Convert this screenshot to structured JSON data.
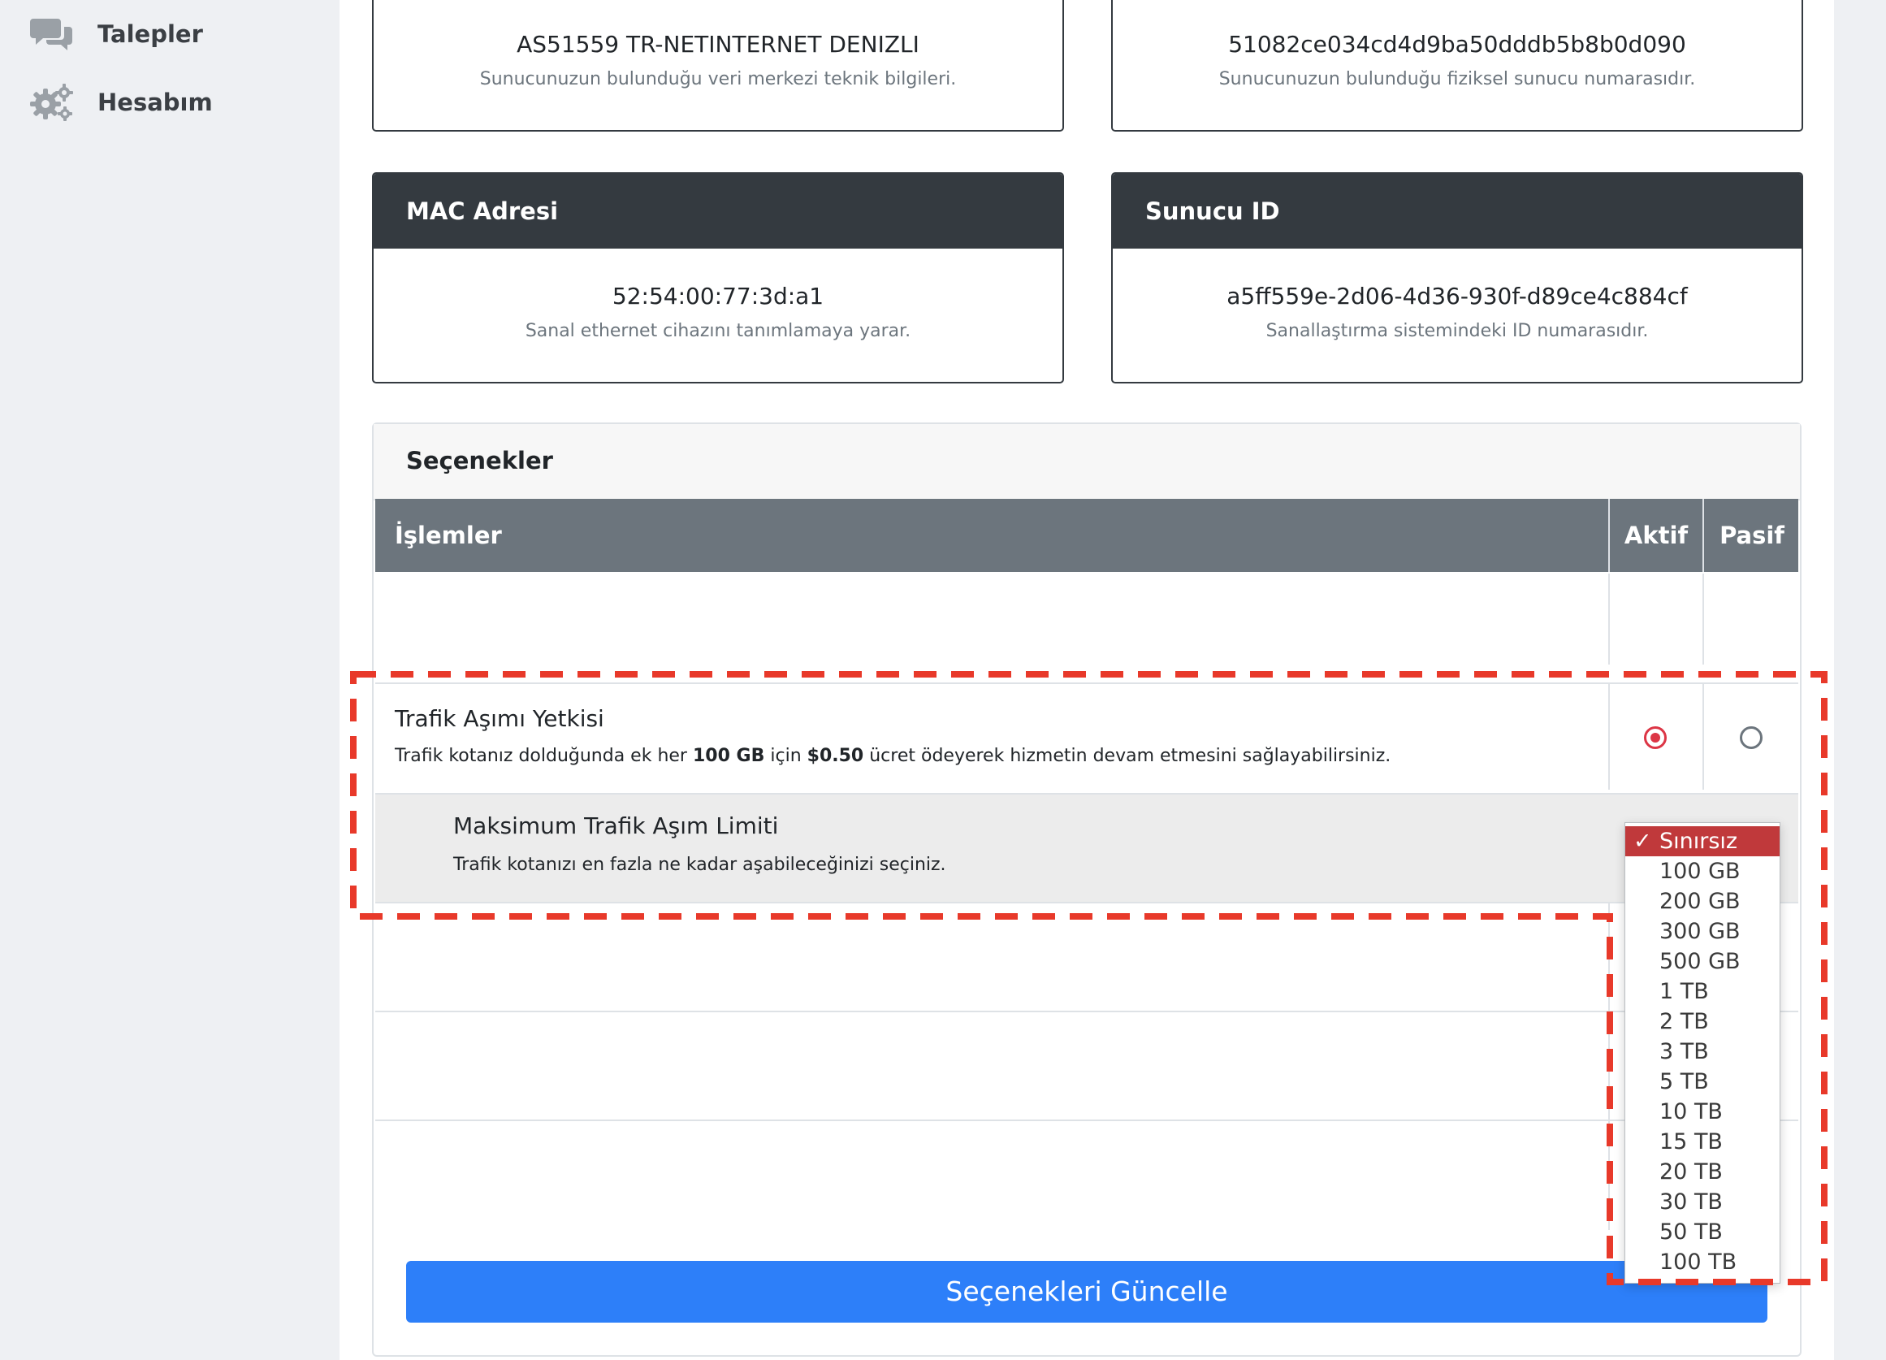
{
  "sidebar": {
    "items": [
      {
        "label": "Talepler",
        "icon": "chat-bubbles-icon"
      },
      {
        "label": "Hesabım",
        "icon": "gears-icon"
      }
    ]
  },
  "cards": {
    "datacenter": {
      "value": "AS51559 TR-NETINTERNET DENIZLI",
      "desc": "Sunucunuzun bulunduğu veri merkezi teknik bilgileri."
    },
    "host": {
      "value": "51082ce034cd4d9ba50dddb5b8b0d090",
      "desc": "Sunucunuzun bulunduğu fiziksel sunucu numarasıdır."
    },
    "mac": {
      "title": "MAC Adresi",
      "value": "52:54:00:77:3d:a1",
      "desc": "Sanal ethernet cihazını tanımlamaya yarar."
    },
    "server_id": {
      "title": "Sunucu ID",
      "value": "a5ff559e-2d06-4d36-930f-d89ce4c884cf",
      "desc": "Sanallaştırma sistemindeki ID numarasıdır."
    }
  },
  "options": {
    "title": "Seçenekler",
    "columns": {
      "operations": "İşlemler",
      "active": "Aktif",
      "passive": "Pasif"
    },
    "traffic_overage": {
      "title": "Trafik Aşımı Yetkisi",
      "desc_pre": "Trafik kotanız dolduğunda ek her ",
      "desc_amount": "100 GB",
      "desc_mid": " için ",
      "desc_price": "$0.50",
      "desc_post": " ücret ödeyerek hizmetin devam etmesini sağlayabilirsiniz.",
      "state": "active"
    },
    "max_overage": {
      "title": "Maksimum Trafik Aşım Limiti",
      "desc": "Trafik kotanızı en fazla ne kadar aşabileceğinizi seçiniz."
    },
    "limit_options": [
      "Sınırsız",
      "100 GB",
      "200 GB",
      "300 GB",
      "500 GB",
      "1 TB",
      "2 TB",
      "3 TB",
      "5 TB",
      "10 TB",
      "15 TB",
      "20 TB",
      "30 TB",
      "50 TB",
      "100 TB"
    ],
    "selected_limit": "Sınırsız",
    "update_button": "Seçenekleri Güncelle"
  },
  "colors": {
    "card_header": "#343a40",
    "table_header": "#6c757d",
    "primary_button": "#2d7ff9",
    "radio_active": "#dc3545",
    "selected_option": "#c0393b",
    "annotation": "#e8392a"
  }
}
